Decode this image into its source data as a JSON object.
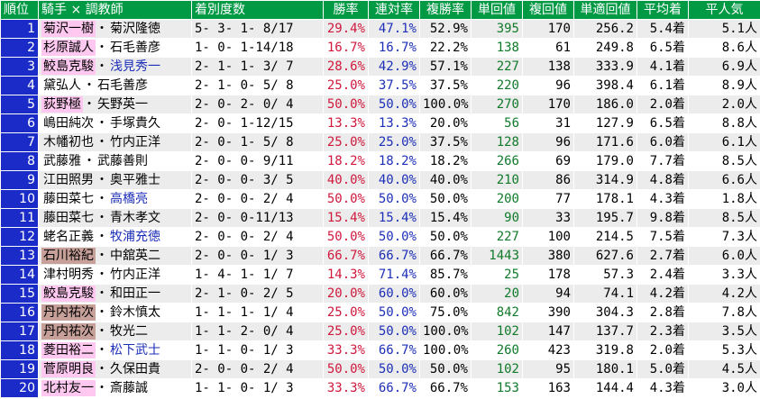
{
  "colors": {
    "header_bg": "#009944",
    "rank_bg": "#1a2bc7",
    "win_rate": "#d0183c",
    "place_rate": "#1c2fb8",
    "win_return": "#107a2a",
    "jockey_pink": "#ffc8f0",
    "jockey_brown": "#c8a09a",
    "trainer_blue": "#1c2fb8"
  },
  "table": {
    "headers": [
      "順位",
      "騎手 × 調教師",
      "着別度数",
      "勝率",
      "連対率",
      "複勝率",
      "単回値",
      "複回値",
      "単適回値",
      "平均着",
      "平人気"
    ],
    "rows": [
      {
        "rank": "1",
        "jockey": "菊沢一樹",
        "jhl": "pink",
        "trainer": "菊沢隆徳",
        "thl": "",
        "dist": "5- 3- 1- 8/17",
        "win": "29.4%",
        "place": "47.1%",
        "show": "52.9%",
        "win_ret": "395",
        "show_ret": "170",
        "adj_ret": "256.2",
        "avg_finish": "5.4着",
        "avg_pop": "5.1人"
      },
      {
        "rank": "2",
        "jockey": "杉原誠人",
        "jhl": "pink",
        "trainer": "石毛善彦",
        "thl": "",
        "dist": "1- 0- 1-14/18",
        "win": "16.7%",
        "place": "16.7%",
        "show": "22.2%",
        "win_ret": "138",
        "show_ret": "61",
        "adj_ret": "249.8",
        "avg_finish": "6.5着",
        "avg_pop": "8.6人"
      },
      {
        "rank": "3",
        "jockey": "鮫島克駿",
        "jhl": "pink",
        "trainer": "浅見秀一",
        "thl": "blue",
        "dist": "2- 1- 1- 3/ 7",
        "win": "28.6%",
        "place": "42.9%",
        "show": "57.1%",
        "win_ret": "227",
        "show_ret": "138",
        "adj_ret": "333.9",
        "avg_finish": "4.1着",
        "avg_pop": "6.9人"
      },
      {
        "rank": "4",
        "jockey": "黛弘人",
        "jhl": "",
        "trainer": "石毛善彦",
        "thl": "",
        "dist": "2- 1- 0- 5/ 8",
        "win": "25.0%",
        "place": "37.5%",
        "show": "37.5%",
        "win_ret": "220",
        "show_ret": "96",
        "adj_ret": "398.4",
        "avg_finish": "6.1着",
        "avg_pop": "8.9人"
      },
      {
        "rank": "5",
        "jockey": "荻野極",
        "jhl": "pink",
        "trainer": "矢野英一",
        "thl": "",
        "dist": "2- 0- 2- 0/ 4",
        "win": "50.0%",
        "place": "50.0%",
        "show": "100.0%",
        "win_ret": "270",
        "show_ret": "170",
        "adj_ret": "186.0",
        "avg_finish": "2.0着",
        "avg_pop": "2.0人"
      },
      {
        "rank": "6",
        "jockey": "嶋田純次",
        "jhl": "",
        "trainer": "手塚貴久",
        "thl": "",
        "dist": "2- 0- 1-12/15",
        "win": "13.3%",
        "place": "13.3%",
        "show": "20.0%",
        "win_ret": "56",
        "show_ret": "31",
        "adj_ret": "127.9",
        "avg_finish": "6.5着",
        "avg_pop": "8.8人"
      },
      {
        "rank": "7",
        "jockey": "木幡初也",
        "jhl": "",
        "trainer": "竹内正洋",
        "thl": "",
        "dist": "2- 0- 1- 5/ 8",
        "win": "25.0%",
        "place": "25.0%",
        "show": "37.5%",
        "win_ret": "128",
        "show_ret": "96",
        "adj_ret": "171.6",
        "avg_finish": "6.0着",
        "avg_pop": "6.1人"
      },
      {
        "rank": "8",
        "jockey": "武藤雅",
        "jhl": "",
        "trainer": "武藤善則",
        "thl": "",
        "dist": "2- 0- 0- 9/11",
        "win": "18.2%",
        "place": "18.2%",
        "show": "18.2%",
        "win_ret": "266",
        "show_ret": "69",
        "adj_ret": "179.0",
        "avg_finish": "7.7着",
        "avg_pop": "8.5人"
      },
      {
        "rank": "9",
        "jockey": "江田照男",
        "jhl": "",
        "trainer": "奥平雅士",
        "thl": "",
        "dist": "2- 0- 0- 3/ 5",
        "win": "40.0%",
        "place": "40.0%",
        "show": "40.0%",
        "win_ret": "210",
        "show_ret": "86",
        "adj_ret": "314.9",
        "avg_finish": "4.8着",
        "avg_pop": "6.6人"
      },
      {
        "rank": "10",
        "jockey": "藤田菜七",
        "jhl": "",
        "trainer": "高橋亮",
        "thl": "blue",
        "dist": "2- 0- 0- 2/ 4",
        "win": "50.0%",
        "place": "50.0%",
        "show": "50.0%",
        "win_ret": "200",
        "show_ret": "77",
        "adj_ret": "178.1",
        "avg_finish": "4.3着",
        "avg_pop": "1.8人"
      },
      {
        "rank": "11",
        "jockey": "藤田菜七",
        "jhl": "",
        "trainer": "青木孝文",
        "thl": "",
        "dist": "2- 0- 0-11/13",
        "win": "15.4%",
        "place": "15.4%",
        "show": "15.4%",
        "win_ret": "90",
        "show_ret": "33",
        "adj_ret": "195.7",
        "avg_finish": "9.8着",
        "avg_pop": "8.5人"
      },
      {
        "rank": "12",
        "jockey": "蛯名正義",
        "jhl": "",
        "trainer": "牧浦充徳",
        "thl": "blue",
        "dist": "2- 0- 0- 2/ 4",
        "win": "50.0%",
        "place": "50.0%",
        "show": "50.0%",
        "win_ret": "227",
        "show_ret": "100",
        "adj_ret": "214.5",
        "avg_finish": "7.5着",
        "avg_pop": "7.3人"
      },
      {
        "rank": "13",
        "jockey": "石川裕紀",
        "jhl": "brown",
        "trainer": "中舘英二",
        "thl": "",
        "dist": "2- 0- 0- 1/ 3",
        "win": "66.7%",
        "place": "66.7%",
        "show": "66.7%",
        "win_ret": "1443",
        "show_ret": "380",
        "adj_ret": "627.6",
        "avg_finish": "2.7着",
        "avg_pop": "6.0人"
      },
      {
        "rank": "14",
        "jockey": "津村明秀",
        "jhl": "",
        "trainer": "竹内正洋",
        "thl": "",
        "dist": "1- 4- 1- 1/ 7",
        "win": "14.3%",
        "place": "71.4%",
        "show": "85.7%",
        "win_ret": "25",
        "show_ret": "178",
        "adj_ret": "57.3",
        "avg_finish": "2.4着",
        "avg_pop": "3.3人"
      },
      {
        "rank": "15",
        "jockey": "鮫島克駿",
        "jhl": "pink",
        "trainer": "和田正一",
        "thl": "",
        "dist": "2- 1- 0- 2/ 5",
        "win": "20.0%",
        "place": "60.0%",
        "show": "60.0%",
        "win_ret": "20",
        "show_ret": "94",
        "adj_ret": "74.1",
        "avg_finish": "4.2着",
        "avg_pop": "4.2人"
      },
      {
        "rank": "16",
        "jockey": "丹内祐次",
        "jhl": "brown",
        "trainer": "鈴木慎太",
        "thl": "",
        "dist": "1- 1- 1- 1/ 4",
        "win": "25.0%",
        "place": "50.0%",
        "show": "75.0%",
        "win_ret": "842",
        "show_ret": "390",
        "adj_ret": "304.3",
        "avg_finish": "2.8着",
        "avg_pop": "7.8人"
      },
      {
        "rank": "17",
        "jockey": "丹内祐次",
        "jhl": "brown",
        "trainer": "牧光二",
        "thl": "",
        "dist": "1- 1- 2- 0/ 4",
        "win": "25.0%",
        "place": "50.0%",
        "show": "100.0%",
        "win_ret": "102",
        "show_ret": "147",
        "adj_ret": "137.7",
        "avg_finish": "2.3着",
        "avg_pop": "3.5人"
      },
      {
        "rank": "18",
        "jockey": "菱田裕二",
        "jhl": "pink",
        "trainer": "松下武士",
        "thl": "blue",
        "dist": "1- 1- 0- 1/ 3",
        "win": "33.3%",
        "place": "66.7%",
        "show": "100.0%",
        "win_ret": "260",
        "show_ret": "423",
        "adj_ret": "319.8",
        "avg_finish": "2.0着",
        "avg_pop": "5.3人"
      },
      {
        "rank": "19",
        "jockey": "菅原明良",
        "jhl": "pink",
        "trainer": "久保田貴",
        "thl": "",
        "dist": "2- 0- 0- 2/ 4",
        "win": "50.0%",
        "place": "50.0%",
        "show": "50.0%",
        "win_ret": "102",
        "show_ret": "95",
        "adj_ret": "180.1",
        "avg_finish": "5.0着",
        "avg_pop": "4.5人"
      },
      {
        "rank": "20",
        "jockey": "北村友一",
        "jhl": "pink",
        "trainer": "斎藤誠",
        "thl": "",
        "dist": "1- 1- 0- 1/ 3",
        "win": "33.3%",
        "place": "66.7%",
        "show": "66.7%",
        "win_ret": "153",
        "show_ret": "163",
        "adj_ret": "144.4",
        "avg_finish": "4.3着",
        "avg_pop": "3.0人"
      }
    ]
  }
}
